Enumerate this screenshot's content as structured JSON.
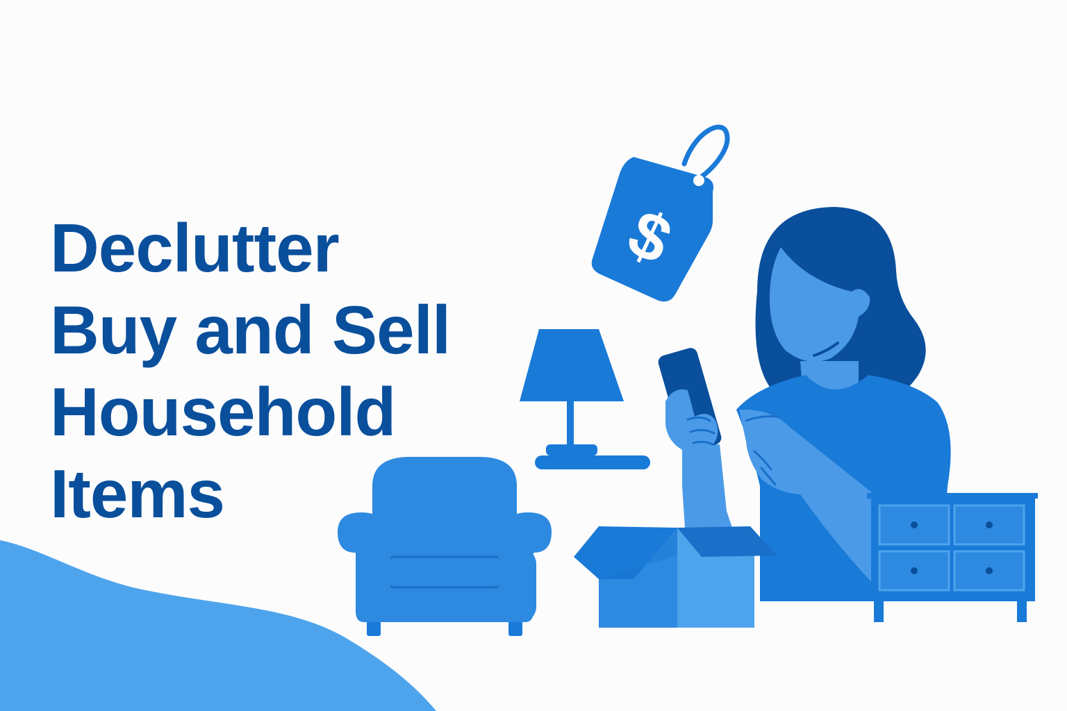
{
  "headline": {
    "line1": "Declutter",
    "line2": "Buy and Sell",
    "line3": "Household",
    "line4": "Items"
  },
  "price_tag": {
    "symbol": "$"
  },
  "colors": {
    "background": "#fcfcfd",
    "headline": "#0a4f9c",
    "primary_blue": "#1a7ad8",
    "dark_blue": "#0a4f9c",
    "mid_blue": "#2d8ae0",
    "light_blue": "#4ea4ec",
    "skin": "#4a9ae8"
  },
  "icons": [
    "price-tag-icon",
    "table-lamp-icon",
    "armchair-icon",
    "cardboard-box-icon",
    "dresser-icon",
    "smartphone-icon",
    "woman-figure"
  ]
}
